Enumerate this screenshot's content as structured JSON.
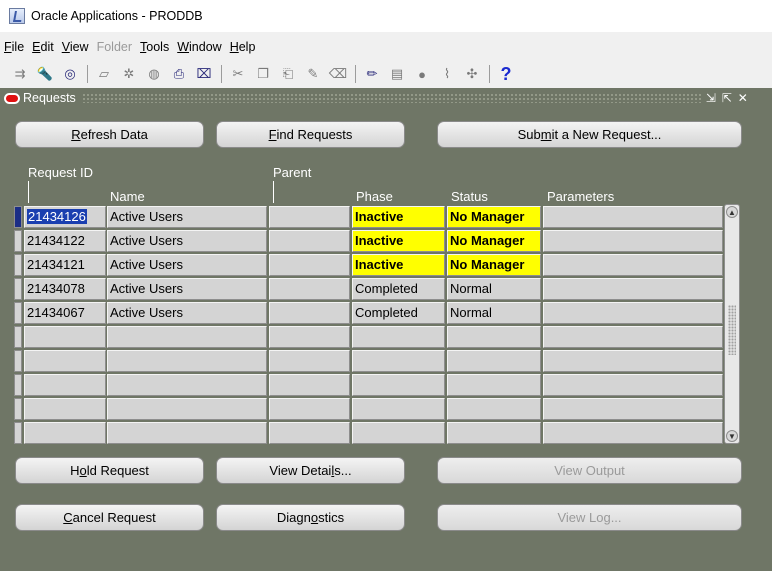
{
  "app": {
    "title": "Oracle Applications - PRODDB"
  },
  "menubar": {
    "items": [
      {
        "pre": "",
        "ul": "F",
        "post": "ile",
        "enabled": true
      },
      {
        "pre": "",
        "ul": "E",
        "post": "dit",
        "enabled": true
      },
      {
        "pre": "",
        "ul": "V",
        "post": "iew",
        "enabled": true
      },
      {
        "pre": "",
        "ul": "F",
        "post": "older",
        "enabled": false
      },
      {
        "pre": "",
        "ul": "T",
        "post": "ools",
        "enabled": true
      },
      {
        "pre": "",
        "ul": "W",
        "post": "indow",
        "enabled": true
      },
      {
        "pre": "",
        "ul": "H",
        "post": "elp",
        "enabled": true
      }
    ]
  },
  "toolbar": {
    "icons": [
      "new-icon",
      "find-icon",
      "navigate-icon",
      "save-icon",
      "next-step-icon",
      "print-icon",
      "close-form-icon",
      "cut-icon",
      "copy-icon",
      "paste-icon",
      "clear-record-icon",
      "delete-record-icon",
      "edit-field-icon",
      "zoom-icon",
      "translations-icon",
      "attachments-icon",
      "folder-tools-icon",
      "help-icon"
    ]
  },
  "window": {
    "title": "Requests",
    "buttons_top": {
      "refresh": {
        "ul": "R",
        "post": "efresh Data"
      },
      "find": {
        "ul": "F",
        "post": "ind Requests"
      },
      "submit": {
        "pre": "Sub",
        "ul": "m",
        "post": "it a New Request..."
      }
    },
    "buttons_bottom": {
      "hold": {
        "pre": "H",
        "ul": "o",
        "post": "ld Request"
      },
      "view_details": {
        "pre": "View Detai",
        "ul": "l",
        "post": "s..."
      },
      "view_output": "View Output",
      "cancel": {
        "ul": "C",
        "post": "ancel Request"
      },
      "diagnostics": {
        "pre": "Diagn",
        "ul": "o",
        "post": "stics"
      },
      "view_log": "View Log..."
    },
    "table": {
      "headers": {
        "request_id": "Request ID",
        "name": "Name",
        "parent": "Parent",
        "phase": "Phase",
        "status": "Status",
        "parameters": "Parameters"
      },
      "rows": [
        {
          "request_id": "21434126",
          "name": "Active Users",
          "parent": "",
          "phase": "Inactive",
          "status": "No Manager",
          "parameters": "",
          "highlight": true,
          "selected": true
        },
        {
          "request_id": "21434122",
          "name": "Active Users",
          "parent": "",
          "phase": "Inactive",
          "status": "No Manager",
          "parameters": "",
          "highlight": true,
          "selected": false
        },
        {
          "request_id": "21434121",
          "name": "Active Users",
          "parent": "",
          "phase": "Inactive",
          "status": "No Manager",
          "parameters": "",
          "highlight": true,
          "selected": false
        },
        {
          "request_id": "21434078",
          "name": "Active Users",
          "parent": "",
          "phase": "Completed",
          "status": "Normal",
          "parameters": "",
          "highlight": false,
          "selected": false
        },
        {
          "request_id": "21434067",
          "name": "Active Users",
          "parent": "",
          "phase": "Completed",
          "status": "Normal",
          "parameters": "",
          "highlight": false,
          "selected": false
        },
        {
          "request_id": "",
          "name": "",
          "parent": "",
          "phase": "",
          "status": "",
          "parameters": "",
          "highlight": false,
          "selected": false
        },
        {
          "request_id": "",
          "name": "",
          "parent": "",
          "phase": "",
          "status": "",
          "parameters": "",
          "highlight": false,
          "selected": false
        },
        {
          "request_id": "",
          "name": "",
          "parent": "",
          "phase": "",
          "status": "",
          "parameters": "",
          "highlight": false,
          "selected": false
        },
        {
          "request_id": "",
          "name": "",
          "parent": "",
          "phase": "",
          "status": "",
          "parameters": "",
          "highlight": false,
          "selected": false
        },
        {
          "request_id": "",
          "name": "",
          "parent": "",
          "phase": "",
          "status": "",
          "parameters": "",
          "highlight": false,
          "selected": false
        }
      ]
    }
  },
  "colors": {
    "window_bg": "#6f7666",
    "highlight": "#ffff00",
    "selection": "#1a3fb0",
    "cell_bg": "#d4d4d4"
  }
}
